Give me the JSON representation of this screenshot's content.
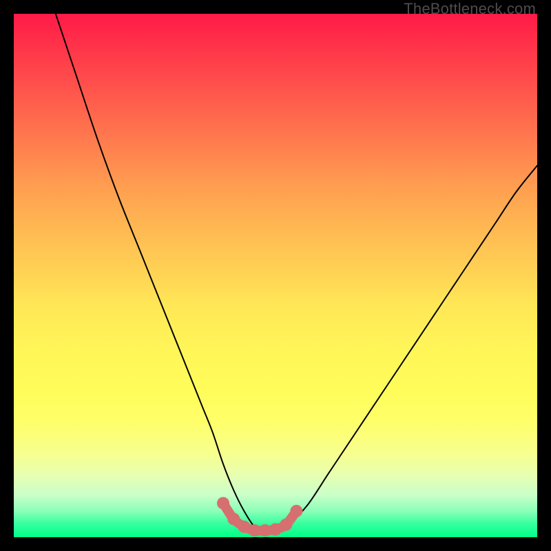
{
  "watermark": "TheBottleneck.com",
  "chart_data": {
    "type": "line",
    "title": "",
    "xlabel": "",
    "ylabel": "",
    "xlim": [
      0,
      100
    ],
    "ylim": [
      0,
      100
    ],
    "grid": false,
    "series": [
      {
        "name": "bottleneck-curve",
        "x": [
          8,
          12,
          16,
          20,
          24,
          28,
          32,
          34,
          36,
          38,
          40,
          42,
          44,
          46,
          48,
          50,
          52,
          56,
          60,
          64,
          68,
          72,
          76,
          80,
          84,
          88,
          92,
          96,
          100
        ],
        "y": [
          100,
          88,
          76,
          65,
          55,
          45,
          35,
          30,
          25,
          20,
          14,
          9,
          5,
          2,
          1,
          1,
          2,
          6,
          12,
          18,
          24,
          30,
          36,
          42,
          48,
          54,
          60,
          66,
          71
        ]
      }
    ],
    "highlight": {
      "name": "optimal-zone",
      "color": "#d66f6f",
      "points_x": [
        40,
        42,
        44,
        46,
        48,
        50,
        52,
        54
      ],
      "points_y": [
        6.5,
        3.5,
        2.0,
        1.3,
        1.3,
        1.5,
        2.4,
        5.0
      ]
    }
  }
}
